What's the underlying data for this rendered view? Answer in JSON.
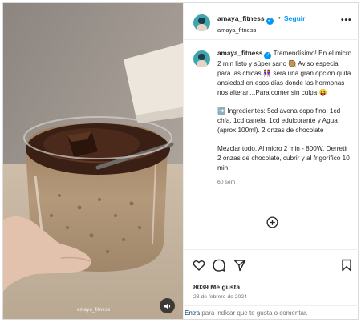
{
  "header": {
    "username": "amaya_fitness",
    "separator": "•",
    "follow_label": "Seguir",
    "subtitle": "amaya_fitness",
    "more_icon": "more-horizontal-icon"
  },
  "caption": {
    "username": "amaya_fitness",
    "intro": "Tremendísimo! En el micro 2 min listo y súper sano 🥘 Aviso especial para las chicas 👭 será una gran opción quita ansiedad en esos días donde las hormonas nos alteran...Para comer sin culpa 😝",
    "ingredients": "➡️ Ingredientes: 5cd avena copo fino, 1cd chía, 1cd canela, 1cd edulcorante y Agua (aprox.100ml). 2 onzas de chocolate",
    "instructions": "Mezclar todo. Al micro 2 min - 800W. Derretir 2 onzas de chocolate, cubrir y al frigorífico 10 min.",
    "time_ago": "60 sem"
  },
  "media": {
    "watermark": "amaya_fitness"
  },
  "actions": {
    "likes": "8039 Me gusta",
    "date": "28 de febrero de 2024"
  },
  "comment": {
    "link_text": "Entra",
    "rest_text": " para indicar que te gusta o comentar."
  },
  "colors": {
    "accent": "#0095f6",
    "border": "#dbdbdb",
    "muted": "#737373",
    "text": "#262626"
  }
}
